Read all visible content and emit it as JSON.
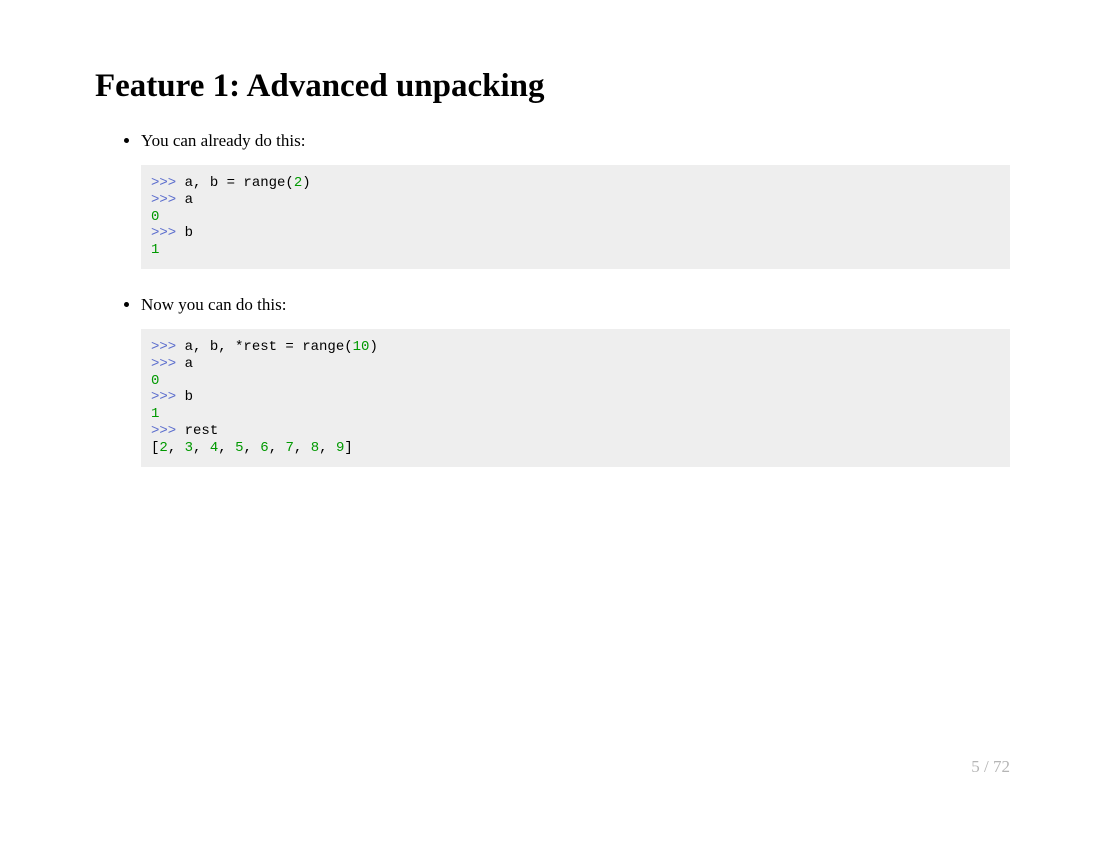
{
  "title": "Feature 1: Advanced unpacking",
  "bullet1_text": "You can already do this:",
  "bullet2_text": "Now you can do this:",
  "page_indicator": "5 / 72",
  "code1": {
    "line1_prompt": ">>> ",
    "line1_body": "a, b = range(",
    "line1_num": "2",
    "line1_close": ")",
    "line2_prompt": ">>> ",
    "line2_body": "a",
    "line3_out": "0",
    "line4_prompt": ">>> ",
    "line4_body": "b",
    "line5_out": "1"
  },
  "code2": {
    "line1_prompt": ">>> ",
    "line1_body": "a, b, *rest = range(",
    "line1_num": "10",
    "line1_close": ")",
    "line2_prompt": ">>> ",
    "line2_body": "a",
    "line3_out": "0",
    "line4_prompt": ">>> ",
    "line4_body": "b",
    "line5_out": "1",
    "line6_prompt": ">>> ",
    "line6_body": "rest",
    "line7_open": "[",
    "line7_n0": "2",
    "line7_c0": ", ",
    "line7_n1": "3",
    "line7_c1": ", ",
    "line7_n2": "4",
    "line7_c2": ", ",
    "line7_n3": "5",
    "line7_c3": ", ",
    "line7_n4": "6",
    "line7_c4": ", ",
    "line7_n5": "7",
    "line7_c5": ", ",
    "line7_n6": "8",
    "line7_c6": ", ",
    "line7_n7": "9",
    "line7_close": "]"
  }
}
